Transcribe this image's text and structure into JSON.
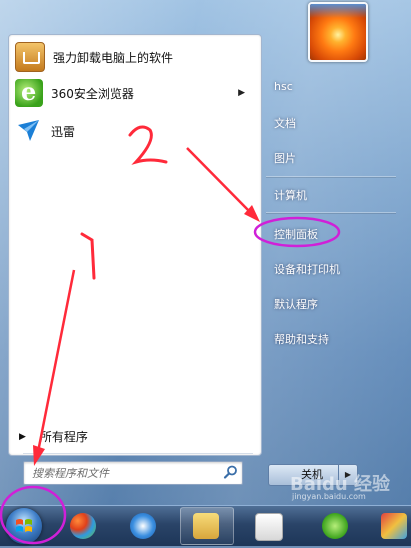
{
  "programs": [
    {
      "label": "强力卸载电脑上的软件",
      "icon": "uninstaller-icon",
      "has_submenu": false
    },
    {
      "label": "360安全浏览器",
      "icon": "360-browser-icon",
      "has_submenu": true
    },
    {
      "label": "迅雷",
      "icon": "xunlei-icon",
      "has_submenu": false
    }
  ],
  "all_programs_label": "所有程序",
  "search": {
    "placeholder": "搜索程序和文件"
  },
  "right_menu": {
    "user": "hsc",
    "documents": "文档",
    "pictures": "图片",
    "computer": "计算机",
    "control_panel": "控制面板",
    "devices_printers": "设备和打印机",
    "default_programs": "默认程序",
    "help_support": "帮助和支持"
  },
  "shutdown_label": "关机",
  "annotations": {
    "step1": "1",
    "step2": "2",
    "highlight_color": "#d020d8",
    "arrow_color": "#ff2a3a"
  },
  "watermark": {
    "main": "Baidu 经验",
    "sub": "jingyan.baidu.com"
  }
}
